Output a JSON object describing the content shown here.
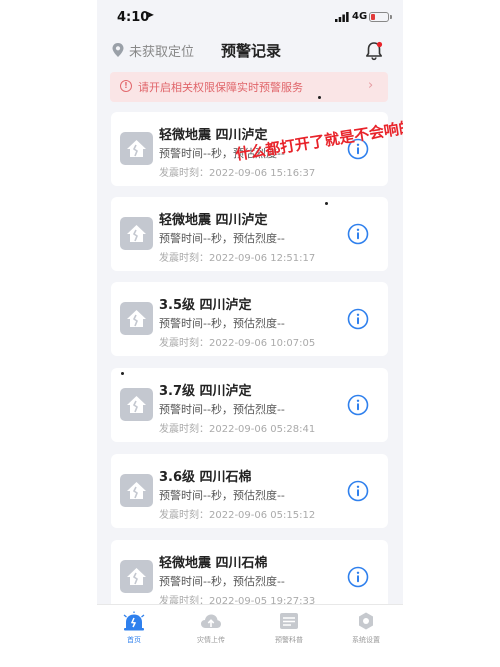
{
  "status_bar": {
    "time": "4:10",
    "network": "4G"
  },
  "header": {
    "location": "未获取定位",
    "title": "预警记录"
  },
  "banner": {
    "text": "请开启相关权限保障实时预警服务"
  },
  "overlay_text": "什么都打开了就是不会响的",
  "records": [
    {
      "title": "轻微地震 四川泸定",
      "subtitle": "预警时间--秒，预估烈度--",
      "time": "发震时刻：2022-09-06 15:16:37"
    },
    {
      "title": "轻微地震 四川泸定",
      "subtitle": "预警时间--秒，预估烈度--",
      "time": "发震时刻：2022-09-06 12:51:17"
    },
    {
      "title": "3.5级 四川泸定",
      "subtitle": "预警时间--秒，预估烈度--",
      "time": "发震时刻：2022-09-06 10:07:05"
    },
    {
      "title": "3.7级 四川泸定",
      "subtitle": "预警时间--秒，预估烈度--",
      "time": "发震时刻：2022-09-06 05:28:41"
    },
    {
      "title": "3.6级 四川石棉",
      "subtitle": "预警时间--秒，预估烈度--",
      "time": "发震时刻：2022-09-06 05:15:12"
    },
    {
      "title": "轻微地震 四川石棉",
      "subtitle": "预警时间--秒，预估烈度--",
      "time": "发震时刻：2022-09-05 19:27:33"
    }
  ],
  "tabs": [
    {
      "label": "首页",
      "icon": "home-alert-icon",
      "active": true
    },
    {
      "label": "灾情上传",
      "icon": "cloud-upload-icon",
      "active": false
    },
    {
      "label": "预警科普",
      "icon": "book-icon",
      "active": false
    },
    {
      "label": "系统设置",
      "icon": "gear-icon",
      "active": false
    }
  ],
  "colors": {
    "accent": "#2f80ed",
    "banner_bg": "#fae5e6",
    "banner_text": "#e0656a",
    "overlay": "#e8232a"
  }
}
